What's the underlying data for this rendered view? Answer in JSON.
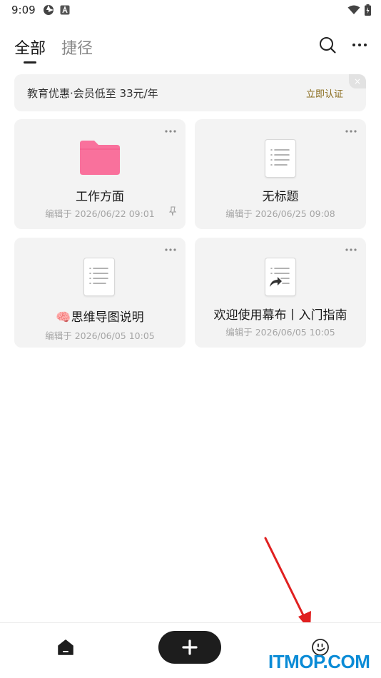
{
  "status_bar": {
    "time": "9:09",
    "left_icons": [
      "aperture-icon",
      "a-badge-icon"
    ],
    "right_icons": [
      "wifi-icon",
      "battery-icon"
    ]
  },
  "header": {
    "tabs": [
      {
        "label": "全部",
        "active": true
      },
      {
        "label": "捷径",
        "active": false
      }
    ],
    "actions": [
      "search-icon",
      "more-icon"
    ]
  },
  "promo": {
    "text": "教育优惠·会员低至 33元/年",
    "action_label": "立即认证",
    "close_glyph": "×"
  },
  "cards": [
    {
      "title": "工作方面",
      "meta": "编辑于 2026/06/22 09:01",
      "icon": "folder-icon",
      "pinned": true
    },
    {
      "title": "无标题",
      "meta": "编辑于 2026/06/25 09:08",
      "icon": "document-icon",
      "pinned": false
    },
    {
      "title": "🧠思维导图说明",
      "meta": "编辑于 2026/06/05 10:05",
      "icon": "document-icon",
      "pinned": false
    },
    {
      "title": "欢迎使用幕布丨入门指南",
      "meta": "编辑于 2026/06/05 10:05",
      "icon": "shared-document-icon",
      "pinned": false
    }
  ],
  "bottom_nav": {
    "items": [
      "home-icon",
      "add-button",
      "profile-icon"
    ]
  },
  "watermark": "ITMOP.COM",
  "colors": {
    "folder": "#f9719c",
    "card_bg": "#f3f3f3",
    "promo_action": "#8a6d1f",
    "add_button": "#1d1d1d",
    "watermark": "#0a8bd6",
    "arrow": "#e02020"
  }
}
